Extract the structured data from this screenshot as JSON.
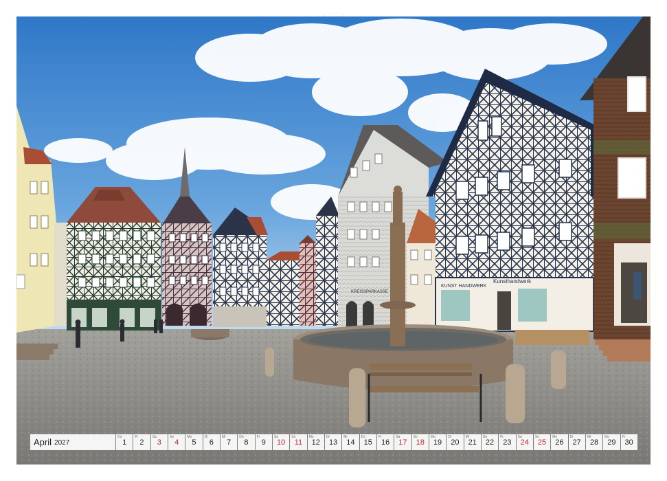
{
  "calendar": {
    "month": "April",
    "year": "2027",
    "days": [
      {
        "d": "1",
        "w": "Do"
      },
      {
        "d": "2",
        "w": "Fr"
      },
      {
        "d": "3",
        "w": "Sa",
        "weekend": true
      },
      {
        "d": "4",
        "w": "So",
        "weekend": true
      },
      {
        "d": "5",
        "w": "Mo"
      },
      {
        "d": "6",
        "w": "Di"
      },
      {
        "d": "7",
        "w": "Mi"
      },
      {
        "d": "8",
        "w": "Do"
      },
      {
        "d": "9",
        "w": "Fr"
      },
      {
        "d": "10",
        "w": "Sa",
        "weekend": true
      },
      {
        "d": "11",
        "w": "So",
        "weekend": true
      },
      {
        "d": "12",
        "w": "Mo"
      },
      {
        "d": "13",
        "w": "Di"
      },
      {
        "d": "14",
        "w": "Mi"
      },
      {
        "d": "15",
        "w": "Do"
      },
      {
        "d": "16",
        "w": "Fr"
      },
      {
        "d": "17",
        "w": "Sa",
        "weekend": true
      },
      {
        "d": "18",
        "w": "So",
        "weekend": true
      },
      {
        "d": "19",
        "w": "Mo"
      },
      {
        "d": "20",
        "w": "Di"
      },
      {
        "d": "21",
        "w": "Mi"
      },
      {
        "d": "22",
        "w": "Do"
      },
      {
        "d": "23",
        "w": "Fr"
      },
      {
        "d": "24",
        "w": "Sa",
        "weekend": true
      },
      {
        "d": "25",
        "w": "So",
        "weekend": true
      },
      {
        "d": "26",
        "w": "Mo"
      },
      {
        "d": "27",
        "w": "Di"
      },
      {
        "d": "28",
        "w": "Mi"
      },
      {
        "d": "29",
        "w": "Do"
      },
      {
        "d": "30",
        "w": "Fr"
      }
    ]
  },
  "signs": {
    "shop_left": "KREISSPARKASSE",
    "shop_mid": "KUNST HANDWERK",
    "shop_right": "Kunsthandwerk"
  },
  "colors": {
    "sky": "#3f86d0",
    "timber": "#23324a",
    "roof": "#a94e34",
    "cobble": "#8c8a86",
    "weekend": "#c62828"
  }
}
